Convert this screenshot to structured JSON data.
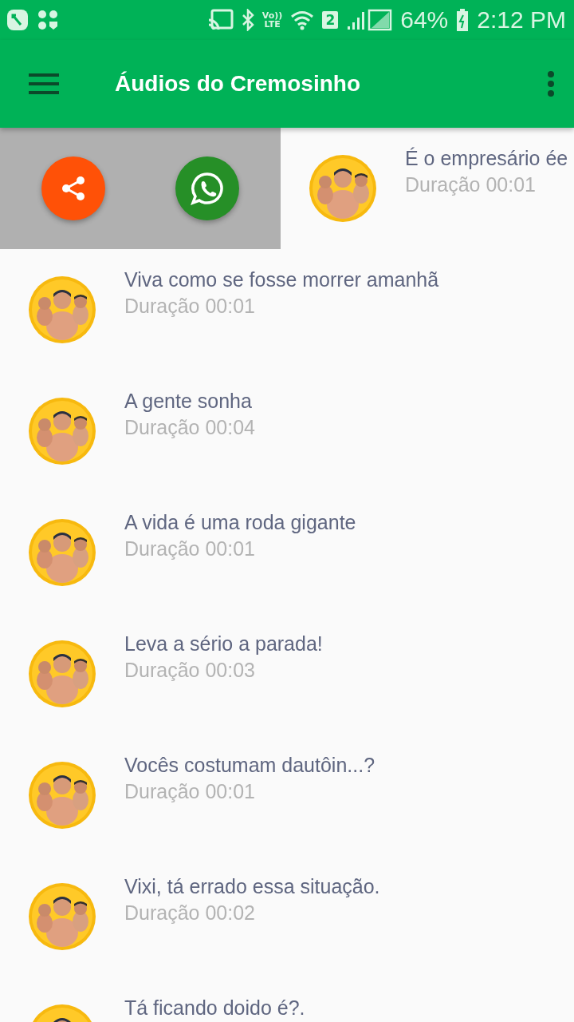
{
  "status_bar": {
    "volte_top": "Vo))",
    "volte_bottom": "LTE",
    "sim": "2",
    "battery": "64%",
    "time": "2:12 PM"
  },
  "app_bar": {
    "title": "Áudios do Cremosinho"
  },
  "audios": [
    {
      "title": "É o empresário ée",
      "duration": "Duração 00:01",
      "swiped": true
    },
    {
      "title": "Viva como se fosse morrer amanhã",
      "duration": "Duração 00:01",
      "swiped": false
    },
    {
      "title": "A gente sonha",
      "duration": "Duração 00:04",
      "swiped": false
    },
    {
      "title": "A vida é uma roda gigante",
      "duration": "Duração 00:01",
      "swiped": false
    },
    {
      "title": "Leva a sério a parada!",
      "duration": "Duração 00:03",
      "swiped": false
    },
    {
      "title": "Vocês costumam dautôin...?",
      "duration": "Duração 00:01",
      "swiped": false
    },
    {
      "title": "Vixi, tá errado essa situação.",
      "duration": "Duração 00:02",
      "swiped": false
    },
    {
      "title": "Tá ficando doido é?.",
      "swiped": false
    }
  ]
}
